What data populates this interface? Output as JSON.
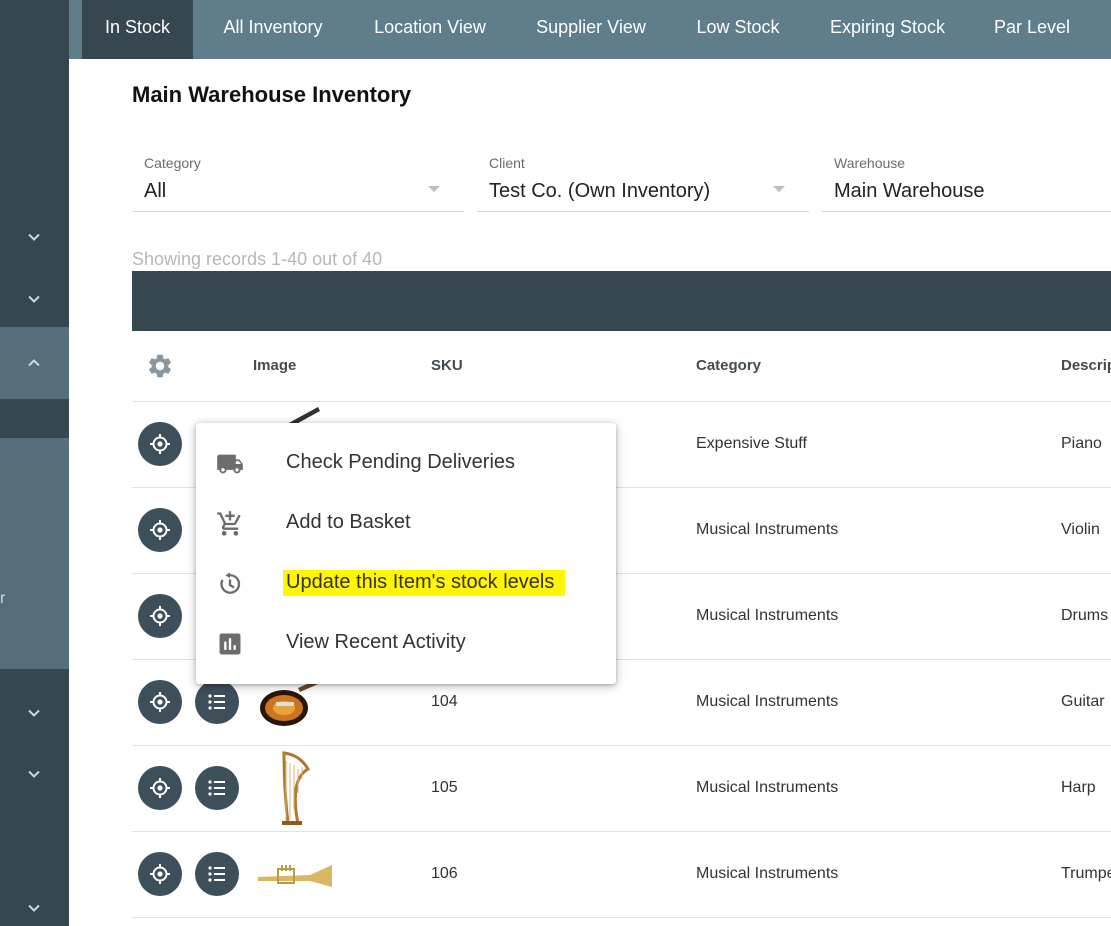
{
  "tabs": [
    {
      "label": "In Stock",
      "active": true
    },
    {
      "label": "All Inventory"
    },
    {
      "label": "Location View"
    },
    {
      "label": "Supplier View"
    },
    {
      "label": "Low Stock"
    },
    {
      "label": "Expiring Stock"
    },
    {
      "label": "Par Level"
    }
  ],
  "sidebar": {
    "cut_label": "r"
  },
  "page": {
    "title": "Main Warehouse Inventory",
    "records_text": "Showing records 1-40 out of 40"
  },
  "filters": {
    "category": {
      "label": "Category",
      "value": "All"
    },
    "client": {
      "label": "Client",
      "value": "Test Co. (Own Inventory)"
    },
    "warehouse": {
      "label": "Warehouse",
      "value": "Main Warehouse"
    }
  },
  "table": {
    "headers": {
      "image": "Image",
      "sku": "SKU",
      "category": "Category",
      "description": "Descrip"
    },
    "rows": [
      {
        "sku": "",
        "category": "Expensive Stuff",
        "description": "Piano",
        "thumb": "piano-image"
      },
      {
        "sku": "",
        "category": "Musical Instruments",
        "description": "Violin",
        "thumb": "violin-image"
      },
      {
        "sku": "",
        "category": "Musical Instruments",
        "description": "Drums",
        "thumb": "drums-image"
      },
      {
        "sku": "104",
        "category": "Musical Instruments",
        "description": "Guitar",
        "thumb": "guitar-image"
      },
      {
        "sku": "105",
        "category": "Musical Instruments",
        "description": "Harp",
        "thumb": "harp-image"
      },
      {
        "sku": "106",
        "category": "Musical Instruments",
        "description": "Trumpe",
        "thumb": "trumpet-image"
      }
    ]
  },
  "menu": {
    "items": [
      {
        "label": "Check Pending Deliveries",
        "icon": "truck-icon"
      },
      {
        "label": "Add to Basket",
        "icon": "add-to-cart-icon"
      },
      {
        "label": "Update this Item's stock levels",
        "icon": "history-icon",
        "highlighted": true
      },
      {
        "label": "View Recent Activity",
        "icon": "bar-chart-icon"
      }
    ]
  },
  "colors": {
    "sidebar": "#37474f",
    "tabbar": "#5f7d8a",
    "table_header_bar": "#37474f",
    "highlight": "#fff600"
  }
}
